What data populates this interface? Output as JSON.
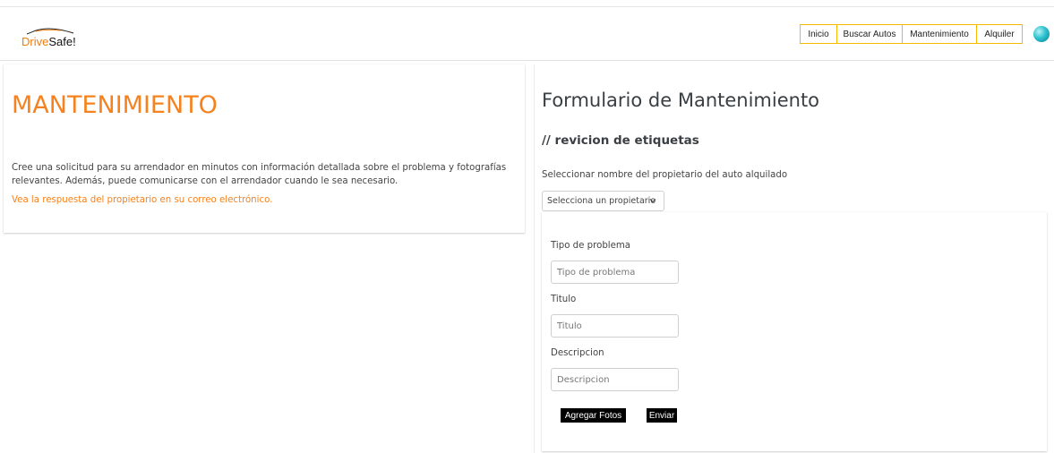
{
  "brand": {
    "logo_part1": "Drive",
    "logo_part2": "Safe!"
  },
  "nav": {
    "items": [
      "Inicio",
      "Buscar Autos",
      "Mantenimiento",
      "Alquiler"
    ]
  },
  "intro": {
    "title": "MANTENIMIENTO",
    "description": "Cree una solicitud para su arrendador en minutos con información detallada sobre el problema y fotografías relevantes. Además, puede comunicarse con el arrendador cuando le sea necesario.",
    "note": "Vea la respuesta del propietario en su correo electrónico."
  },
  "form": {
    "title": "Formulario de Mantenimiento",
    "subtitle": "// revicion de etiquetas",
    "owner_label": "Seleccionar nombre del propietario del auto alquilado",
    "owner_select_value": "Selecciona un propietario",
    "fields": [
      {
        "label": "Tipo de problema",
        "placeholder": "Tipo de problema"
      },
      {
        "label": "Titulo",
        "placeholder": "Titulo"
      },
      {
        "label": "Descripcion",
        "placeholder": "Descripcion"
      }
    ],
    "add_photos_label": "Agregar Fotos",
    "submit_label": "Enviar"
  },
  "colors": {
    "accent": "#f5821f",
    "nav_border": "#f5b800",
    "button_bg": "#000000"
  },
  "icons": {
    "logo": "car-logo-icon",
    "avatar": "user-avatar-icon",
    "dropdown": "chevron-down-icon"
  }
}
